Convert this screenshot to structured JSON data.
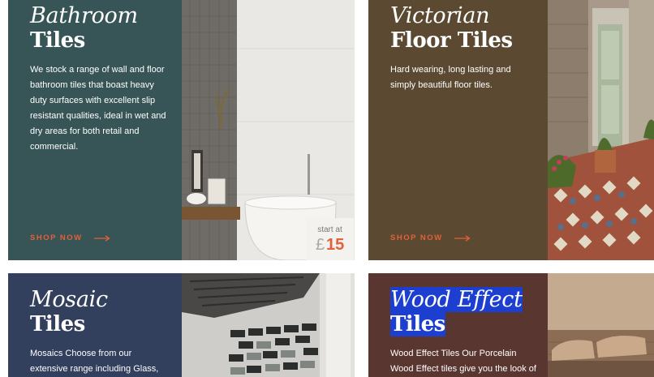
{
  "cards": {
    "bathroom": {
      "title_italic": "Bathroom",
      "title_bold": "Tiles",
      "description": "We stock a range of wall and floor bathroom tiles that boast heavy duty surfaces with excellent slip resistant qualities, ideal in wet and dry areas for both retail and commercial.",
      "shop_label": "SHOP NOW",
      "price_label": "start at",
      "price_currency": "£",
      "price_amount": "15",
      "panel_color": "#375456"
    },
    "victorian": {
      "title_italic": "Victorian",
      "title_bold": "Floor Tiles",
      "description": "Hard wearing, long lasting and simply beautiful floor tiles.",
      "shop_label": "SHOP NOW",
      "panel_color": "#5b4a31"
    },
    "mosaic": {
      "title_italic": "Mosaic",
      "title_bold": "Tiles",
      "description": "Mosaics Choose from our extensive range including Glass,",
      "panel_color": "#323f5d"
    },
    "wood": {
      "title_italic": "Wood Effect",
      "title_bold": "Tiles",
      "description": "Wood Effect Tiles Our Porcelain Wood Effect tiles give you the look of",
      "panel_color": "#5a3630"
    }
  },
  "accent_color": "#e2603a"
}
